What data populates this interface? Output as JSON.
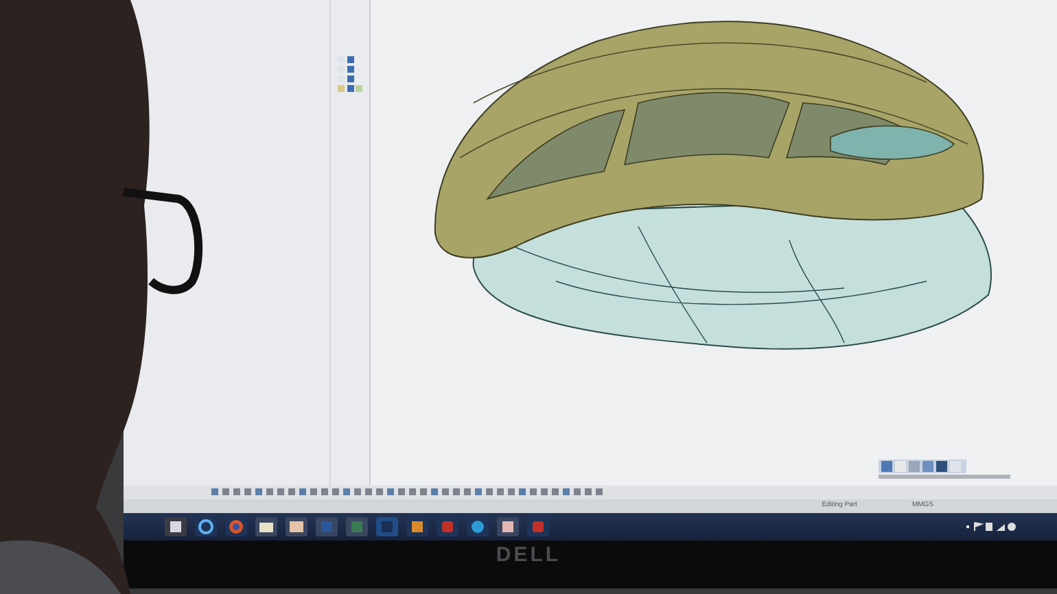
{
  "status_bar": {
    "texts": [
      "Editing Part",
      "MMGS"
    ]
  },
  "taskbar": {
    "apps": [
      {
        "kind": "media"
      },
      {
        "kind": "ie"
      },
      {
        "kind": "firefox"
      },
      {
        "kind": "folder"
      },
      {
        "kind": "mail"
      },
      {
        "kind": "word"
      },
      {
        "kind": "sheet"
      },
      {
        "kind": "ps"
      },
      {
        "kind": "ai"
      },
      {
        "kind": "cad"
      },
      {
        "kind": "skype"
      },
      {
        "kind": "slides"
      },
      {
        "kind": "cad"
      }
    ]
  },
  "monitor": {
    "brand": "DELL"
  }
}
